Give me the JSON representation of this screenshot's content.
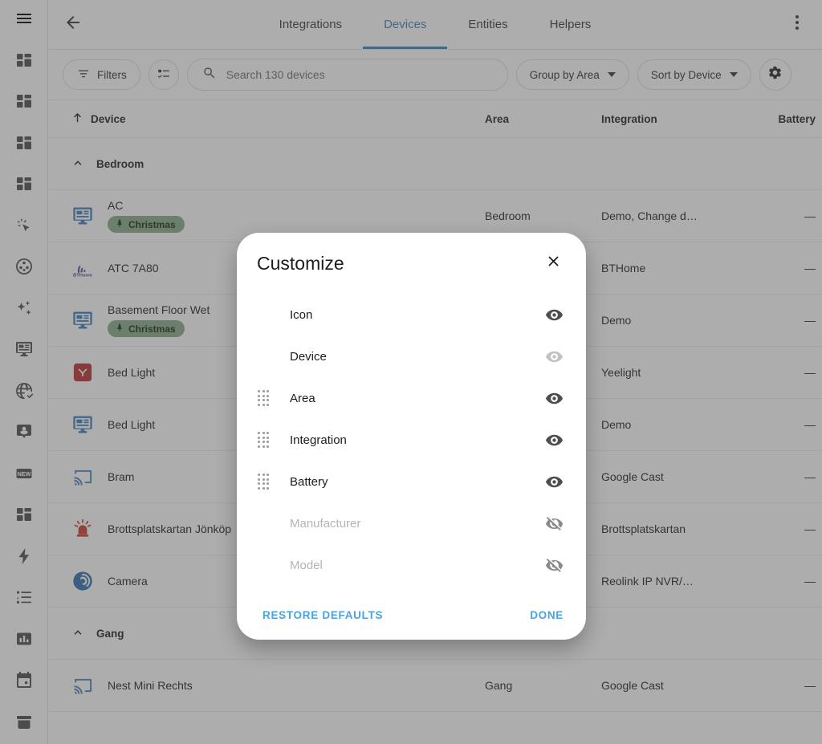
{
  "sidebar": {
    "menu_icon": "hamburger-menu-icon",
    "items": [
      {
        "icon": "dashboard-grid-icon",
        "name": "overview"
      },
      {
        "icon": "dashboard-grid-icon",
        "name": "dashboard-2"
      },
      {
        "icon": "dashboard-grid-icon",
        "name": "dashboard-3"
      },
      {
        "icon": "dashboard-grid-icon",
        "name": "dashboard-4"
      },
      {
        "icon": "cursor-click-icon",
        "name": "cursor"
      },
      {
        "icon": "film-reel-icon",
        "name": "media"
      },
      {
        "icon": "sparkles-icon",
        "name": "sparkles"
      },
      {
        "icon": "monitor-dashboard-icon",
        "name": "monitor"
      },
      {
        "icon": "globe-check-icon",
        "name": "globe"
      },
      {
        "icon": "account-badge-icon",
        "name": "person"
      },
      {
        "icon": "new-badge-icon",
        "name": "new"
      },
      {
        "icon": "dashboard-grid-icon",
        "name": "dashboard-5"
      },
      {
        "icon": "lightning-bolt-icon",
        "name": "energy"
      },
      {
        "icon": "list-check-icon",
        "name": "todo"
      },
      {
        "icon": "bar-chart-icon",
        "name": "history"
      },
      {
        "icon": "calendar-icon",
        "name": "calendar"
      },
      {
        "icon": "archive-icon",
        "name": "logbook"
      }
    ]
  },
  "topbar": {
    "back_icon": "arrow-left-icon",
    "overflow_icon": "more-vertical-icon",
    "tabs": [
      {
        "label": "Integrations",
        "active": false
      },
      {
        "label": "Devices",
        "active": true
      },
      {
        "label": "Entities",
        "active": false
      },
      {
        "label": "Helpers",
        "active": false
      }
    ],
    "accent_color": "#3d7ba8"
  },
  "toolbar": {
    "filters_label": "Filters",
    "filters_icon": "filter-icon",
    "selection_icon": "checklist-icon",
    "search": {
      "placeholder": "Search 130 devices",
      "value": "",
      "icon": "search-icon"
    },
    "group_by_label": "Group by Area",
    "sort_by_label": "Sort by Device",
    "settings_icon": "gear-icon"
  },
  "table": {
    "columns": {
      "device": "Device",
      "area": "Area",
      "integration": "Integration",
      "battery": "Battery"
    },
    "sort_icon": "arrow-up-icon",
    "groups": [
      {
        "name": "Bedroom",
        "rows": [
          {
            "icon": "monitor-dashboard-icon",
            "icon_color": "#3d7ab5",
            "name": "AC",
            "badge": "Christmas",
            "badge_icon": "tree-icon",
            "area": "Bedroom",
            "integration": "Demo, Change d…",
            "battery": "—"
          },
          {
            "icon": "bthome-icon",
            "icon_color": "#3c4a8a",
            "name": "ATC 7A80",
            "badge": "",
            "area": "",
            "integration": "BTHome",
            "battery": "—"
          },
          {
            "icon": "monitor-dashboard-icon",
            "icon_color": "#3d7ab5",
            "name": "Basement Floor Wet",
            "badge": "Christmas",
            "badge_icon": "tree-icon",
            "area": "",
            "integration": "Demo",
            "battery": "—"
          },
          {
            "icon": "yeelight-icon",
            "icon_color": "#b52a2a",
            "name": "Bed Light",
            "badge": "",
            "area": "",
            "integration": "Yeelight",
            "battery": "—"
          },
          {
            "icon": "monitor-dashboard-icon",
            "icon_color": "#3d7ab5",
            "name": "Bed Light",
            "badge": "",
            "area": "",
            "integration": "Demo",
            "battery": "—"
          },
          {
            "icon": "cast-icon",
            "icon_color": "#4a7fb5",
            "name": "Bram",
            "badge": "",
            "area": "",
            "integration": "Google Cast",
            "battery": "—"
          },
          {
            "icon": "alarm-light-icon",
            "icon_color": "#c23a2a",
            "name": "Brottsplatskartan Jönköp",
            "badge": "",
            "area": "",
            "integration": "Brottsplatskartan",
            "battery": "—"
          },
          {
            "icon": "camera-lens-icon",
            "icon_color": "#2d6aa8",
            "name": "Camera",
            "badge": "",
            "area": "",
            "integration": "Reolink IP NVR/…",
            "battery": "—"
          }
        ]
      },
      {
        "name": "Gang",
        "rows": [
          {
            "icon": "cast-icon",
            "icon_color": "#4a7fb5",
            "name": "Nest Mini Rechts",
            "badge": "",
            "area": "Gang",
            "integration": "Google Cast",
            "battery": "—"
          }
        ]
      }
    ]
  },
  "dialog": {
    "title": "Customize",
    "close_icon": "close-icon",
    "options": [
      {
        "label": "Icon",
        "draggable": false,
        "visible": true,
        "state": "on",
        "eye_icon": "eye-icon"
      },
      {
        "label": "Device",
        "draggable": false,
        "visible": true,
        "state": "locked",
        "eye_icon": "eye-icon"
      },
      {
        "label": "Area",
        "draggable": true,
        "visible": true,
        "state": "on",
        "eye_icon": "eye-icon"
      },
      {
        "label": "Integration",
        "draggable": true,
        "visible": true,
        "state": "on",
        "eye_icon": "eye-icon"
      },
      {
        "label": "Battery",
        "draggable": true,
        "visible": true,
        "state": "on",
        "eye_icon": "eye-icon"
      },
      {
        "label": "Manufacturer",
        "draggable": false,
        "visible": false,
        "state": "off",
        "eye_icon": "eye-off-icon"
      },
      {
        "label": "Model",
        "draggable": false,
        "visible": false,
        "state": "off",
        "eye_icon": "eye-off-icon"
      }
    ],
    "restore_label": "RESTORE DEFAULTS",
    "done_label": "DONE",
    "action_color": "#49a3e0"
  }
}
